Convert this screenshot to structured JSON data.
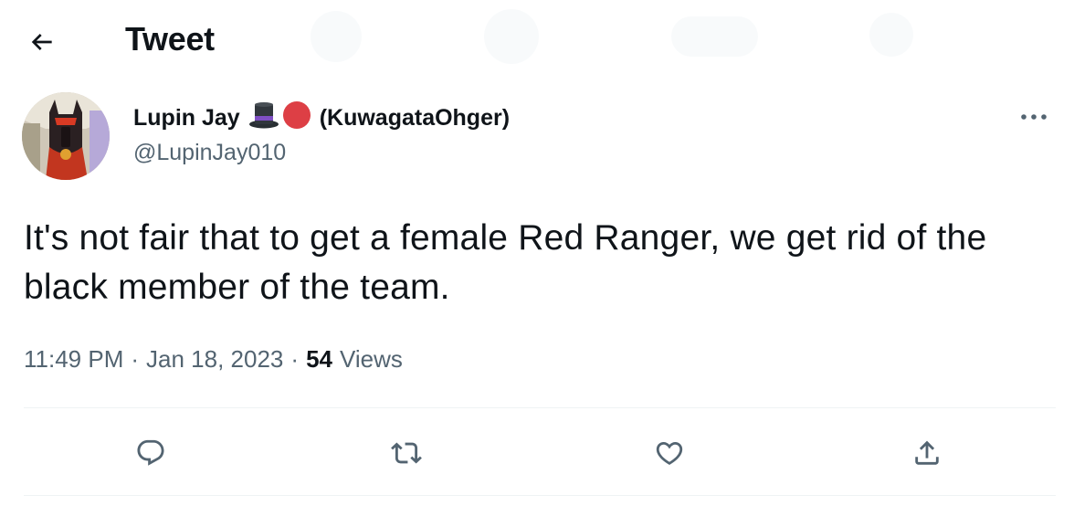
{
  "header": {
    "title": "Tweet"
  },
  "author": {
    "display_name": "Lupin Jay",
    "name_suffix": "(KuwagataOhger)",
    "handle": "@LupinJay010",
    "emoji": [
      "top-hat-emoji",
      "red-circle-emoji"
    ]
  },
  "tweet": {
    "text": "It's not fair that to get a female Red Ranger, we get rid of the black member of the team.",
    "time": "11:49 PM",
    "separator": "·",
    "date": "Jan 18, 2023",
    "views_count": "54",
    "views_label": "Views"
  },
  "actions": [
    "reply-icon",
    "retweet-icon",
    "like-icon",
    "share-icon"
  ],
  "colors": {
    "text": "#0f1419",
    "secondary": "#536471",
    "divider": "#eff3f4",
    "red_circle": "#dd3f45",
    "hat_band": "#7f4fc4"
  }
}
